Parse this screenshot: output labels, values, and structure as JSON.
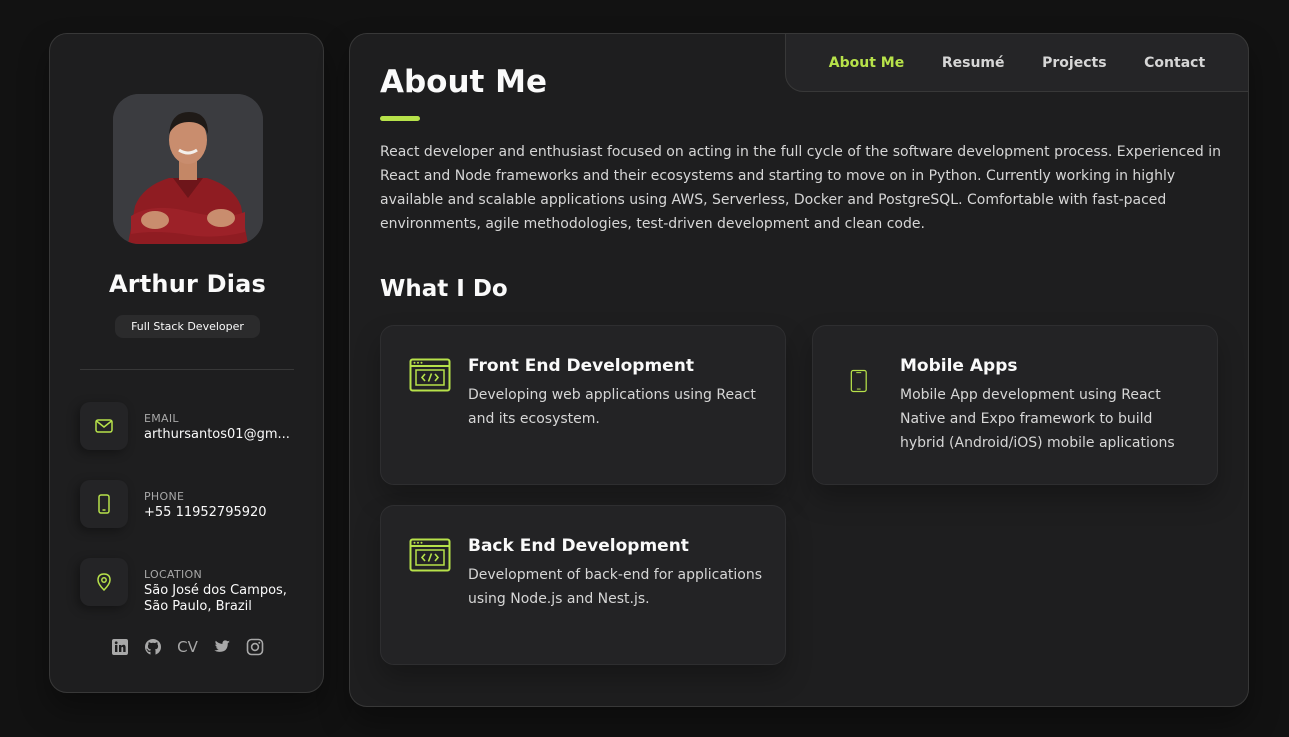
{
  "colors": {
    "accent": "#b7e24a",
    "background": "#121212",
    "card": "#1e1e1f"
  },
  "profile": {
    "name": "Arthur Dias",
    "role": "Full Stack Developer"
  },
  "contacts": [
    {
      "label": "Email",
      "value": "arthursantos01@gm...",
      "icon": "mail-icon"
    },
    {
      "label": "Phone",
      "value": "+55 11952795920",
      "icon": "phone-icon"
    },
    {
      "label": "Location",
      "value": "São José dos Campos, São Paulo, Brazil",
      "icon": "location-pin-icon"
    }
  ],
  "socials": [
    {
      "name": "linkedin-icon"
    },
    {
      "name": "github-icon"
    },
    {
      "name": "cv-link",
      "label": "CV"
    },
    {
      "name": "twitter-icon"
    },
    {
      "name": "instagram-icon"
    }
  ],
  "nav": {
    "items": [
      "About Me",
      "Resumé",
      "Projects",
      "Contact"
    ],
    "active": "About Me"
  },
  "about": {
    "title": "About Me",
    "text": "React developer and enthusiast focused on acting in the full cycle of the software development process. Experienced in React and Node frameworks and their ecosystems and starting to move on in Python. Currently working in highly available and scalable applications using AWS, Serverless, Docker and PostgreSQL. Comfortable with fast-paced environments, agile methodologies, test-driven development and clean code."
  },
  "services": {
    "title": "What I Do",
    "items": [
      {
        "title": "Front End Development",
        "text": "Developing web applications using React and its ecosystem.",
        "icon": "code-window-icon"
      },
      {
        "title": "Mobile Apps",
        "text": "Mobile App development using React Native and Expo framework to build hybrid (Android/iOS) mobile aplications",
        "icon": "smartphone-icon"
      },
      {
        "title": "Back End Development",
        "text": "Development of back-end for applications using Node.js and Nest.js.",
        "icon": "code-window-icon"
      }
    ]
  }
}
